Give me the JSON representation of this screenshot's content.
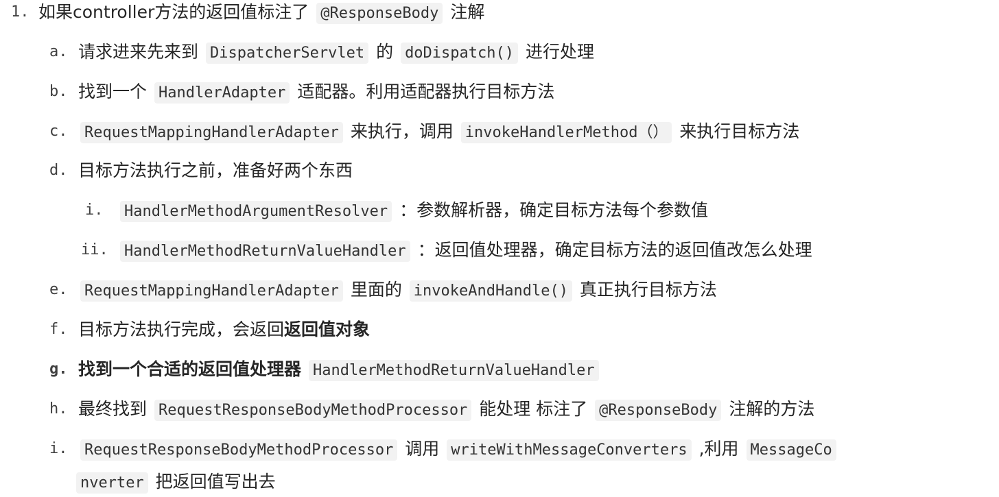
{
  "items": [
    {
      "marker": "1.",
      "text1": "如果controller方法的返回值标注了",
      "code1": "@ResponseBody",
      "text2": "注解"
    },
    {
      "marker": "a.",
      "text1": "请求进来先来到",
      "code1": "DispatcherServlet",
      "text2": "的",
      "code2": "doDispatch()",
      "text3": "进行处理"
    },
    {
      "marker": "b.",
      "text1": "找到一个",
      "code1": "HandlerAdapter",
      "text2": "适配器。利用适配器执行目标方法"
    },
    {
      "marker": "c.",
      "code1": "RequestMappingHandlerAdapter",
      "text1": "来执行，调用",
      "code2": "invokeHandlerMethod（）",
      "text2": "来执行目标方法"
    },
    {
      "marker": "d.",
      "text1": "目标方法执行之前，准备好两个东西"
    },
    {
      "marker": "i.",
      "code1": "HandlerMethodArgumentResolver",
      "text1": "：参数解析器，确定目标方法每个参数值"
    },
    {
      "marker": "ii.",
      "code1": "HandlerMethodReturnValueHandler",
      "text1": "：返回值处理器，确定目标方法的返回值改怎么处理"
    },
    {
      "marker": "e.",
      "code1": "RequestMappingHandlerAdapter",
      "text1": "里面的",
      "code2": "invokeAndHandle()",
      "text2": "真正执行目标方法"
    },
    {
      "marker": "f.",
      "text1": "目标方法执行完成，会返回",
      "bold1": "返回值对象"
    },
    {
      "marker": "g.",
      "bold1": "找到一个合适的返回值处理器",
      "code1": "HandlerMethodReturnValueHandler"
    },
    {
      "marker": "h.",
      "text1": "最终找到",
      "code1": "RequestResponseBodyMethodProcessor",
      "text2": "能处理 标注了",
      "code2": "@ResponseBody",
      "text3": "注解的方法"
    },
    {
      "marker": "i.",
      "code1": "RequestResponseBodyMethodProcessor",
      "text1": "调用",
      "code2": "writeWithMessageConverters",
      "text2": ",利用",
      "code3": "MessageCo"
    },
    {
      "cont": true,
      "code1": "nverter",
      "text1": "把返回值写出去"
    }
  ]
}
